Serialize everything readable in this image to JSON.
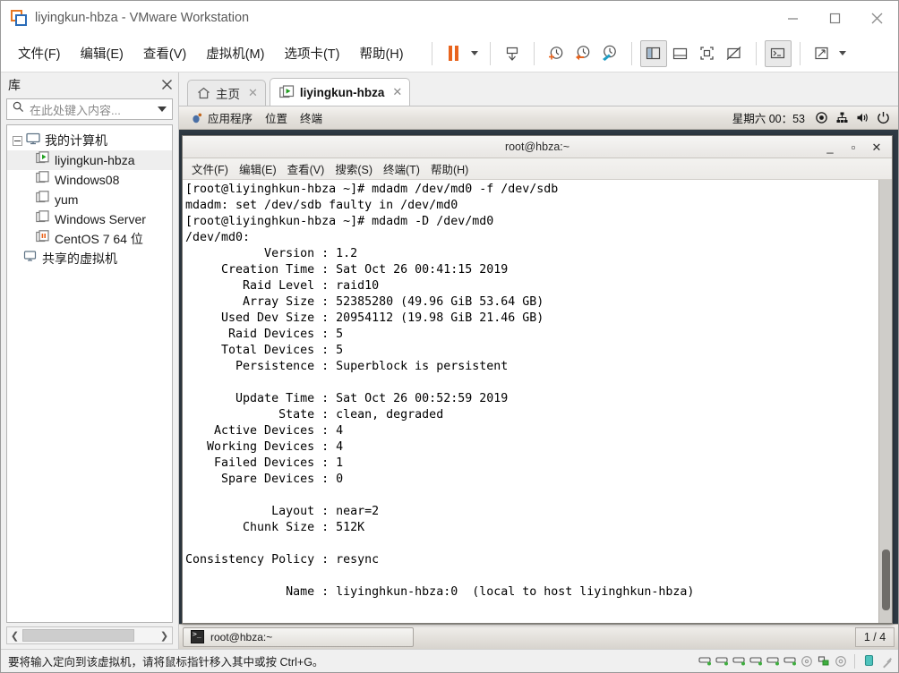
{
  "window": {
    "title": "liyingkun-hbza - VMware Workstation",
    "app_icon": "vmware-logo-icon",
    "controls": [
      {
        "name": "minimize-button",
        "icon": "minimize-icon"
      },
      {
        "name": "maximize-button",
        "icon": "maximize-icon"
      },
      {
        "name": "close-button",
        "icon": "close-icon"
      }
    ]
  },
  "menubar": {
    "items": [
      {
        "label": "文件(F)",
        "name": "menu-file"
      },
      {
        "label": "编辑(E)",
        "name": "menu-edit"
      },
      {
        "label": "查看(V)",
        "name": "menu-view"
      },
      {
        "label": "虚拟机(M)",
        "name": "menu-vm"
      },
      {
        "label": "选项卡(T)",
        "name": "menu-tabs"
      },
      {
        "label": "帮助(H)",
        "name": "menu-help"
      }
    ]
  },
  "toolbar": {
    "buttons": [
      {
        "name": "suspend-button",
        "icon": "pause-icon",
        "accent": "#e8641e"
      },
      {
        "name": "power-dropdown",
        "icon": "chevron-down-icon"
      },
      {
        "name": "send-ctrl-alt-del-button",
        "icon": "keyboard-send-icon"
      },
      {
        "name": "take-snapshot-button",
        "icon": "snapshot-add-icon"
      },
      {
        "name": "revert-snapshot-button",
        "icon": "snapshot-revert-icon"
      },
      {
        "name": "manage-snapshots-button",
        "icon": "snapshot-manage-icon"
      },
      {
        "name": "show-library-button",
        "icon": "sidebar-panel-icon",
        "active": true
      },
      {
        "name": "show-thumbnails-button",
        "icon": "thumbnail-bar-icon"
      },
      {
        "name": "full-screen-button",
        "icon": "fullscreen-frame-icon"
      },
      {
        "name": "unity-mode-button",
        "icon": "unity-mode-icon"
      },
      {
        "name": "console-view-button",
        "icon": "console-prompt-icon",
        "active": true
      },
      {
        "name": "stretch-guest-button",
        "icon": "expand-arrows-icon"
      },
      {
        "name": "stretch-dropdown",
        "icon": "chevron-down-icon"
      }
    ]
  },
  "sidebar": {
    "title": "库",
    "close_icon": "close-icon",
    "search": {
      "placeholder": "在此处键入内容...",
      "value": "",
      "icon": "search-icon",
      "dropdown_icon": "chevron-down-icon"
    },
    "tree": [
      {
        "label": "我的计算机",
        "name": "sidebar-item-my-computer",
        "icon": "monitor-icon",
        "level": 0,
        "expanded": true
      },
      {
        "label": "liyingkun-hbza",
        "name": "sidebar-item-liyingkun-hbza",
        "icon": "vm-running-icon",
        "level": 1,
        "selected": true
      },
      {
        "label": "Windows08",
        "name": "sidebar-item-windows08",
        "icon": "vm-off-icon",
        "level": 1
      },
      {
        "label": "yum",
        "name": "sidebar-item-yum",
        "icon": "vm-off-icon",
        "level": 1
      },
      {
        "label": "Windows Server",
        "name": "sidebar-item-windows-server",
        "icon": "vm-off-icon",
        "level": 1
      },
      {
        "label": "CentOS 7 64 位",
        "name": "sidebar-item-centos7",
        "icon": "vm-suspended-icon",
        "level": 1
      },
      {
        "label": "共享的虚拟机",
        "name": "sidebar-item-shared-vms",
        "icon": "shared-vm-icon",
        "level": 0
      }
    ],
    "hscroll": {
      "left_icon": "chevron-left-icon",
      "right_icon": "chevron-right-icon"
    }
  },
  "tabs": [
    {
      "label": "主页",
      "name": "tab-home",
      "icon": "home-icon",
      "active": false,
      "close_icon": "close-icon"
    },
    {
      "label": "liyingkun-hbza",
      "name": "tab-liyingkun-hbza",
      "icon": "vm-running-icon",
      "active": true,
      "close_icon": "close-icon"
    }
  ],
  "guest": {
    "panel_top": {
      "menus": [
        {
          "label": "应用程序",
          "name": "gnome-menu-applications",
          "icon": "gnome-foot-icon"
        },
        {
          "label": "位置",
          "name": "gnome-menu-places"
        },
        {
          "label": "终端",
          "name": "gnome-menu-terminal"
        }
      ],
      "clock": "星期六 00：53",
      "tray": [
        {
          "name": "accessibility-icon",
          "icon": "target-icon"
        },
        {
          "name": "network-icon",
          "icon": "network-wired-icon"
        },
        {
          "name": "volume-icon",
          "icon": "speaker-icon"
        },
        {
          "name": "power-menu-icon",
          "icon": "power-icon"
        }
      ]
    },
    "terminal": {
      "title": "root@hbza:~",
      "controls": [
        {
          "name": "terminal-minimize-button",
          "icon": "minimize-icon",
          "glyph": "_"
        },
        {
          "name": "terminal-maximize-button",
          "icon": "maximize-icon",
          "glyph": "▫"
        },
        {
          "name": "terminal-close-button",
          "icon": "close-icon",
          "glyph": "✕"
        }
      ],
      "menu": [
        {
          "label": "文件(F)",
          "name": "terminal-menu-file"
        },
        {
          "label": "编辑(E)",
          "name": "terminal-menu-edit"
        },
        {
          "label": "查看(V)",
          "name": "terminal-menu-view"
        },
        {
          "label": "搜索(S)",
          "name": "terminal-menu-search"
        },
        {
          "label": "终端(T)",
          "name": "terminal-menu-terminal"
        },
        {
          "label": "帮助(H)",
          "name": "terminal-menu-help"
        }
      ],
      "content": "[root@liyinghkun-hbza ~]# mdadm /dev/md0 -f /dev/sdb\nmdadm: set /dev/sdb faulty in /dev/md0\n[root@liyinghkun-hbza ~]# mdadm -D /dev/md0\n/dev/md0:\n           Version : 1.2\n     Creation Time : Sat Oct 26 00:41:15 2019\n        Raid Level : raid10\n        Array Size : 52385280 (49.96 GiB 53.64 GB)\n     Used Dev Size : 20954112 (19.98 GiB 21.46 GB)\n      Raid Devices : 5\n     Total Devices : 5\n       Persistence : Superblock is persistent\n\n       Update Time : Sat Oct 26 00:52:59 2019\n             State : clean, degraded\n    Active Devices : 4\n   Working Devices : 4\n    Failed Devices : 1\n     Spare Devices : 0\n\n            Layout : near=2\n        Chunk Size : 512K\n\nConsistency Policy : resync\n\n              Name : liyinghkun-hbza:0  (local to host liyinghkun-hbza)",
      "scrollbar": {
        "name": "terminal-scrollbar"
      }
    },
    "panel_bottom": {
      "window_button": {
        "label": "root@hbza:~",
        "name": "taskbar-window-terminal",
        "icon": "terminal-icon"
      },
      "workspace": "1 / 4"
    }
  },
  "statusbar": {
    "message": "要将输入定向到该虚拟机，请将鼠标指针移入其中或按 Ctrl+G。",
    "devices": [
      {
        "name": "status-harddisk-1-icon",
        "icon": "harddisk-icon"
      },
      {
        "name": "status-harddisk-2-icon",
        "icon": "harddisk-icon"
      },
      {
        "name": "status-harddisk-3-icon",
        "icon": "harddisk-icon"
      },
      {
        "name": "status-harddisk-4-icon",
        "icon": "harddisk-icon"
      },
      {
        "name": "status-harddisk-5-icon",
        "icon": "harddisk-icon"
      },
      {
        "name": "status-harddisk-6-icon",
        "icon": "harddisk-icon"
      },
      {
        "name": "status-cdrom-icon",
        "icon": "cdrom-icon"
      },
      {
        "name": "status-network-icon",
        "icon": "network-icon"
      },
      {
        "name": "status-sound-icon",
        "icon": "sound-icon"
      },
      {
        "name": "status-usb-icon",
        "icon": "usb-icon"
      }
    ]
  }
}
